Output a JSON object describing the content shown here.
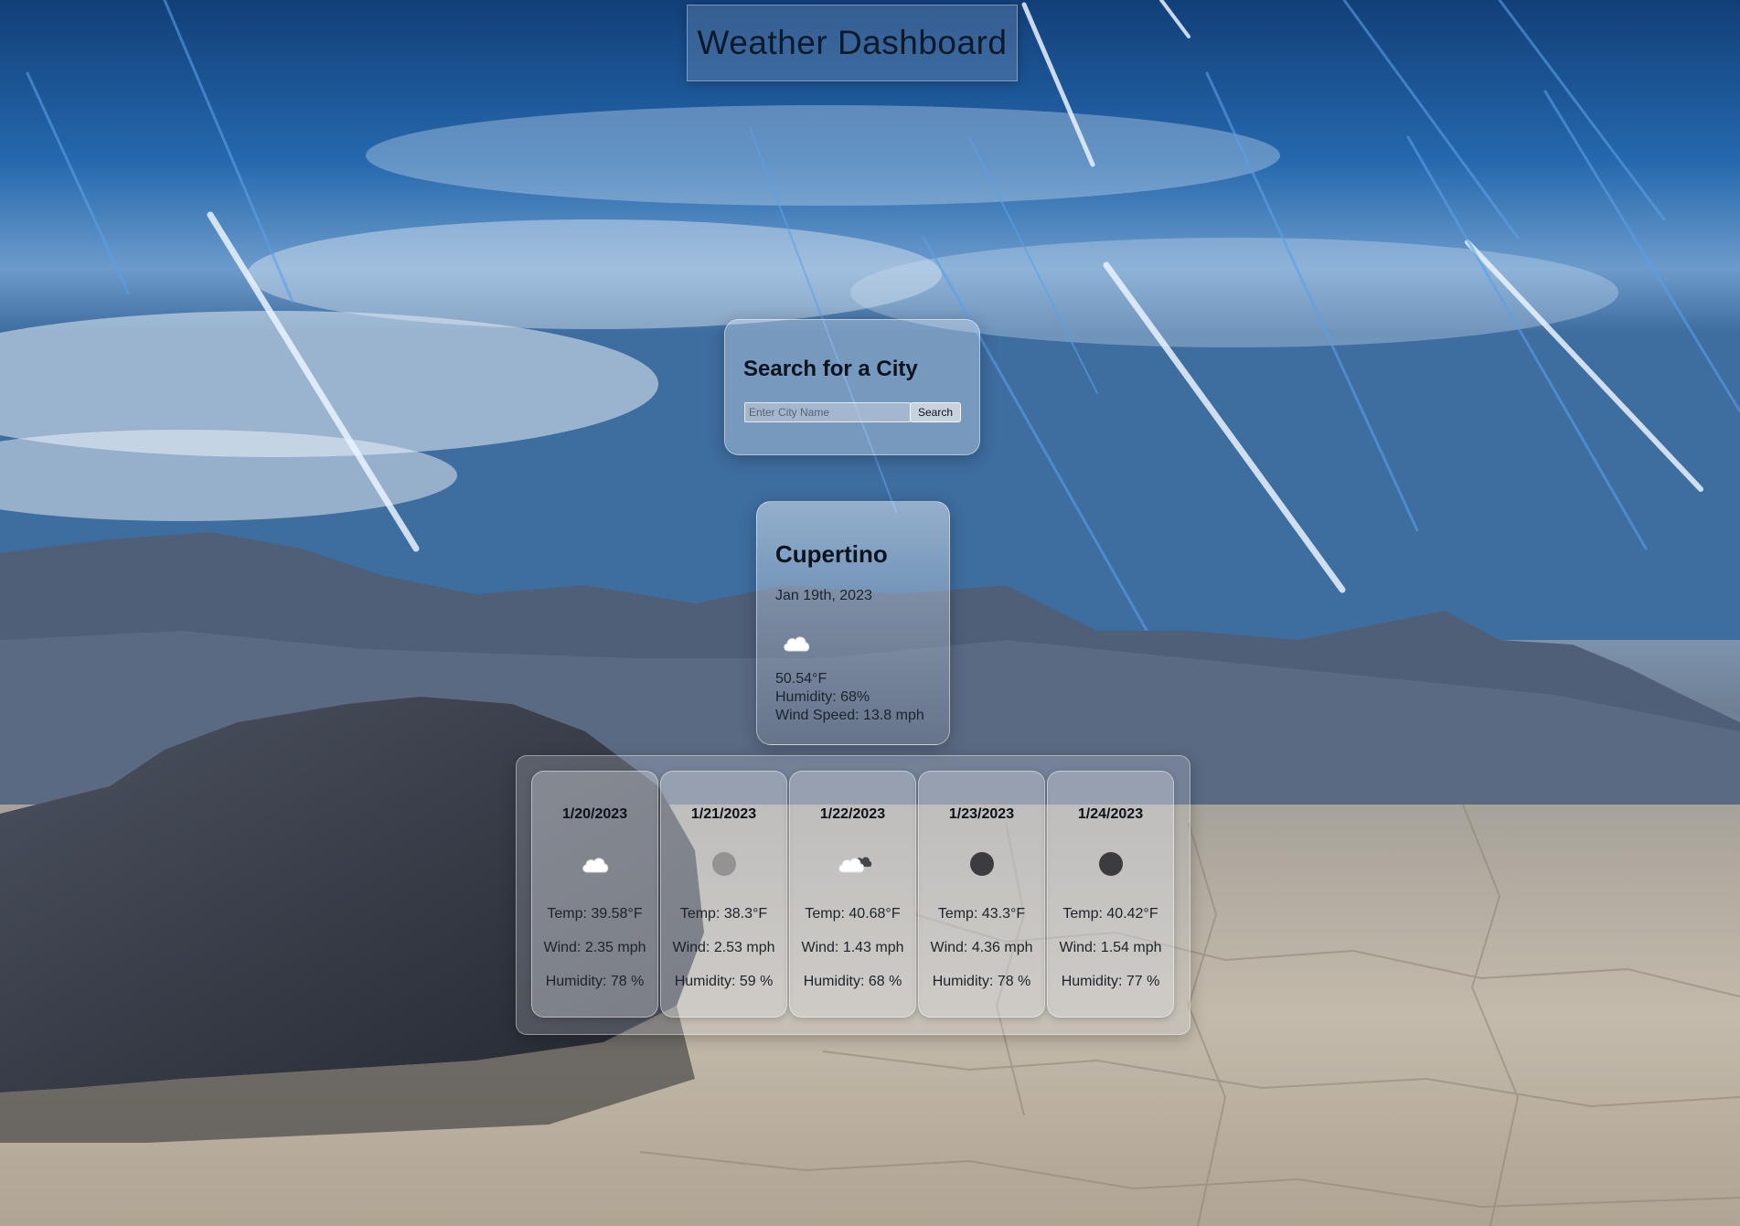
{
  "header": {
    "title": "Weather Dashboard"
  },
  "search": {
    "heading": "Search for a City",
    "placeholder": "Enter City Name",
    "value": "",
    "button_label": "Search"
  },
  "current": {
    "city": "Cupertino",
    "date": "Jan 19th, 2023",
    "icon": "cloud-icon",
    "temp": "50.54°F",
    "humidity": "Humidity: 68%",
    "wind": "Wind Speed: 13.8 mph"
  },
  "forecast": [
    {
      "date": "1/20/2023",
      "icon": "cloud-icon",
      "temp": "Temp: 39.58°F",
      "wind": "Wind: 2.35 mph",
      "humidity": "Humidity: 78 %"
    },
    {
      "date": "1/21/2023",
      "icon": "dark-circle-icon",
      "temp": "Temp: 38.3°F",
      "wind": "Wind: 2.53 mph",
      "humidity": "Humidity: 59 %"
    },
    {
      "date": "1/22/2023",
      "icon": "cloud-dark-cloud-icon",
      "temp": "Temp: 40.68°F",
      "wind": "Wind: 1.43 mph",
      "humidity": "Humidity: 68 %"
    },
    {
      "date": "1/23/2023",
      "icon": "dark-circle-icon",
      "temp": "Temp: 43.3°F",
      "wind": "Wind: 4.36 mph",
      "humidity": "Humidity: 78 %"
    },
    {
      "date": "1/24/2023",
      "icon": "dark-circle-icon",
      "temp": "Temp: 40.42°F",
      "wind": "Wind: 1.54 mph",
      "humidity": "Humidity: 77 %"
    }
  ],
  "colors": {
    "title_text": "#0b1a2b",
    "icon_dark": "#3c3c40",
    "icon_cloud": "#ffffff"
  }
}
